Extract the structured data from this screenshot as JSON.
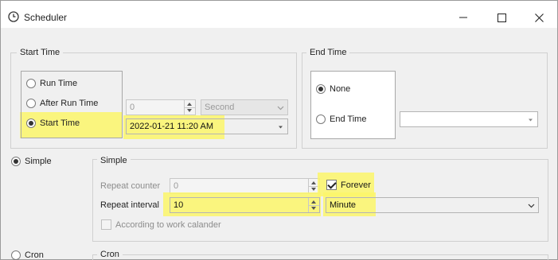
{
  "window": {
    "title": "Scheduler",
    "icon": "clock-icon",
    "controls": {
      "minimize": "minimize-icon",
      "maximize": "maximize-icon",
      "close": "close-icon"
    }
  },
  "start_time": {
    "group_label": "Start Time",
    "options": [
      {
        "label": "Run Time",
        "checked": false
      },
      {
        "label": "After Run Time",
        "checked": false
      },
      {
        "label": "Start Time",
        "checked": true
      }
    ],
    "after_run_value": "0",
    "after_run_unit": "Second",
    "start_datetime": "2022-01-21 11:20 AM"
  },
  "end_time": {
    "group_label": "End Time",
    "options": [
      {
        "label": "None",
        "checked": true
      },
      {
        "label": "End Time",
        "checked": false
      }
    ],
    "end_datetime": ""
  },
  "mode": {
    "simple_label": "Simple",
    "simple_checked": true,
    "cron_label": "Cron",
    "cron_checked": false
  },
  "simple": {
    "group_label": "Simple",
    "repeat_counter_label": "Repeat counter",
    "repeat_counter_value": "0",
    "forever_label": "Forever",
    "forever_checked": true,
    "repeat_interval_label": "Repeat interval",
    "repeat_interval_value": "10",
    "repeat_interval_unit": "Minute",
    "work_calendar_label": "According to work calander",
    "work_calendar_checked": false
  },
  "cron": {
    "group_label": "Cron"
  },
  "colors": {
    "highlight": "#fbf66a",
    "window_bg": "#f0f0f0"
  }
}
